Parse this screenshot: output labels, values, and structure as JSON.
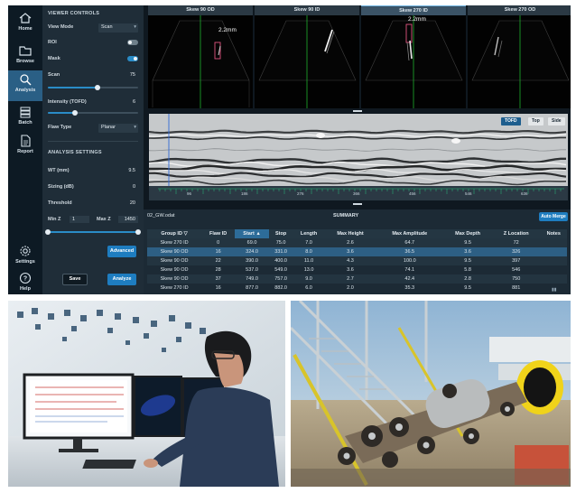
{
  "nav": {
    "items": [
      {
        "label": "Home",
        "icon": "home-icon"
      },
      {
        "label": "Browse",
        "icon": "folder-icon"
      },
      {
        "label": "Analysis",
        "icon": "analysis-icon",
        "active": true
      },
      {
        "label": "Batch",
        "icon": "batch-icon"
      },
      {
        "label": "Report",
        "icon": "report-icon"
      }
    ],
    "bottom": [
      {
        "label": "Settings",
        "icon": "gear-icon"
      },
      {
        "label": "Help",
        "icon": "help-icon"
      }
    ]
  },
  "viewer_controls": {
    "title": "VIEWER CONTROLS",
    "view_mode_label": "View Mode",
    "view_mode_value": "Scan",
    "roi_label": "ROI",
    "roi_on": false,
    "mask_label": "Mask",
    "mask_on": true,
    "scan_label": "Scan",
    "scan_value": "75",
    "scan_fraction": 0.55,
    "intensity_label": "Intensity (TOFD)",
    "intensity_value": "6",
    "intensity_fraction": 0.3,
    "flaw_type_label": "Flaw Type",
    "flaw_type_value": "Planar"
  },
  "analysis_settings": {
    "title": "ANALYSIS SETTINGS",
    "wt_label": "WT (mm)",
    "wt_value": "9.5",
    "sizing_label": "Sizing (dB)",
    "sizing_value": "0",
    "threshold_label": "Threshold",
    "threshold_value": "20",
    "min_z_label": "Min Z",
    "min_z_value": "1",
    "max_z_label": "Max Z",
    "max_z_value": "1450",
    "advanced_label": "Advanced",
    "save_label": "Save",
    "analyze_label": "Analyze"
  },
  "scan_panels": [
    {
      "title": "Skew 90 OD",
      "annotation": "2.2mm",
      "selected": false
    },
    {
      "title": "Skew 90 ID",
      "annotation": "",
      "selected": false
    },
    {
      "title": "Skew 270 ID",
      "annotation": "2.2mm",
      "selected": true
    },
    {
      "title": "Skew 270 OD",
      "annotation": "",
      "selected": false
    }
  ],
  "bscan": {
    "tabs": [
      {
        "label": "TOFD",
        "active": true
      },
      {
        "label": "Top",
        "active": false
      },
      {
        "label": "Side",
        "active": false
      }
    ],
    "ruler_labels": [
      "96",
      "186",
      "276",
      "366",
      "456",
      "546",
      "636"
    ]
  },
  "summary": {
    "file_name": "02_GW.odat",
    "title": "SUMMARY",
    "auto_merge_label": "Auto Merge",
    "columns": [
      "Group ID",
      "Flaw ID",
      "Start",
      "Stop",
      "Length",
      "Max Height",
      "Max Amplitude",
      "Max Depth",
      "Z Location",
      "Notes"
    ],
    "sorted_column": "Start",
    "rows": [
      [
        "Skew 270 ID",
        "0",
        "69.0",
        "75.0",
        "7.0",
        "2.6",
        "64.7",
        "9.5",
        "72",
        ""
      ],
      [
        "Skew 90 OD",
        "16",
        "324.0",
        "331.0",
        "8.0",
        "3.6",
        "36.5",
        "3.6",
        "326",
        ""
      ],
      [
        "Skew 90 OD",
        "22",
        "390.0",
        "400.0",
        "11.0",
        "4.3",
        "100.0",
        "9.5",
        "397",
        ""
      ],
      [
        "Skew 90 OD",
        "28",
        "537.0",
        "549.0",
        "13.0",
        "3.6",
        "74.1",
        "5.8",
        "546",
        ""
      ],
      [
        "Skew 90 OD",
        "37",
        "749.0",
        "757.0",
        "9.0",
        "2.7",
        "42.4",
        "2.8",
        "750",
        ""
      ],
      [
        "Skew 270 ID",
        "16",
        "877.0",
        "882.0",
        "6.0",
        "2.0",
        "35.3",
        "9.5",
        "881",
        ""
      ]
    ],
    "highlight_row": 1
  },
  "colors": {
    "accent": "#1e7dc0",
    "nav_bg": "#0d1a24",
    "panel_bg": "#1f2d38",
    "viewer_bg": "#0f1820"
  }
}
